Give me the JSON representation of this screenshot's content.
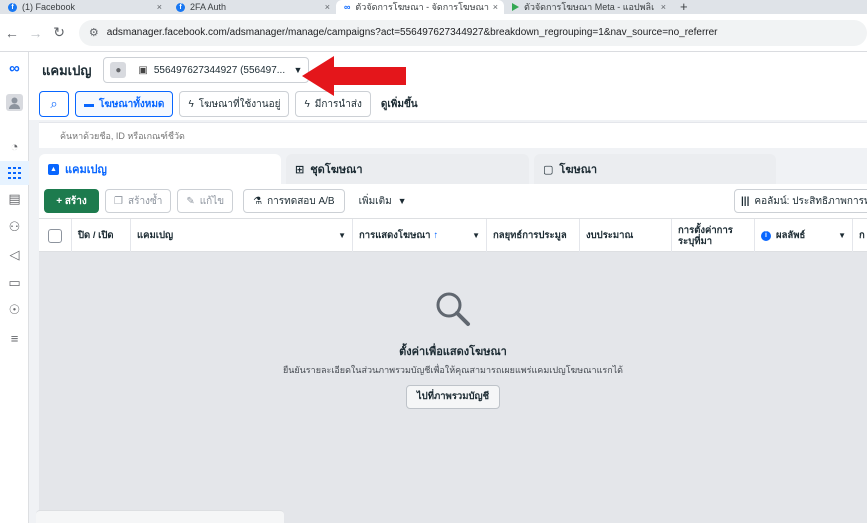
{
  "browser": {
    "tabs": [
      {
        "title": "(1) Facebook",
        "favicon": "facebook-icon"
      },
      {
        "title": "2FA Auth",
        "favicon": "facebook-icon"
      },
      {
        "title": "ตัวจัดการโฆษณา - จัดการโฆษณา - แ",
        "favicon": "meta-icon"
      },
      {
        "title": "ตัวจัดการโฆษณา Meta - แอปพลิเค",
        "favicon": "play-icon"
      }
    ],
    "close_glyph": "×",
    "newtab_glyph": "+",
    "url": "adsmanager.facebook.com/adsmanager/manage/campaigns?act=556497627344927&breakdown_regrouping=1&nav_source=no_referrer"
  },
  "header": {
    "title": "แคมเปญ",
    "account_text": "556497627344927 (556497..."
  },
  "toolbar": {
    "filters": [
      {
        "label": "โฆษณาทั้งหมด",
        "icon": "folder-icon",
        "active": true
      },
      {
        "label": "โฆษณาที่ใช้งานอยู่",
        "icon": "bolt-icon",
        "active": false
      },
      {
        "label": "มีการนำส่ง",
        "icon": "bolt-icon",
        "active": false
      }
    ],
    "more_views": "ดูเพิ่มขึ้น"
  },
  "search": {
    "placeholder": "ค้นหาด้วยชื่อ, ID หรือเกณฑ์ชี้วัด"
  },
  "level_tabs": [
    {
      "label": "แคมเปญ",
      "active": true
    },
    {
      "label": "ชุดโฆษณา",
      "active": false
    },
    {
      "label": "โฆษณา",
      "active": false
    }
  ],
  "actions": {
    "create": "+ สร้าง",
    "duplicate": "สร้างซ้ำ",
    "edit": "แก้ไข",
    "ab_test": "การทดสอบ A/B",
    "more": "เพิ่มเติม",
    "columns": "คอลัมน์: ประสิทธิภาพการทำงาน"
  },
  "table": {
    "columns": [
      {
        "label": "ปิด / เปิด"
      },
      {
        "label": "แคมเปญ"
      },
      {
        "label": "การแสดงโฆษณา"
      },
      {
        "label": "กลยุทธ์การประมูล"
      },
      {
        "label": "งบประมาณ"
      },
      {
        "label": "การตั้งค่าการระบุที่มา"
      },
      {
        "label": "ผลลัพธ์"
      },
      {
        "label": "ก"
      }
    ]
  },
  "empty_state": {
    "title": "ตั้งค่าเพื่อแสดงโฆษณา",
    "description": "ยืนยันรายละเอียดในส่วนภาพรวมบัญชีเพื่อให้คุณสามารถเผยแพร่แคมเปญโฆษณาแรกได้",
    "button": "ไปที่ภาพรวมบัญชี"
  },
  "colors": {
    "accent": "#0866ff",
    "create_green": "#1d7b4e",
    "annotation_red": "#e4161b"
  }
}
